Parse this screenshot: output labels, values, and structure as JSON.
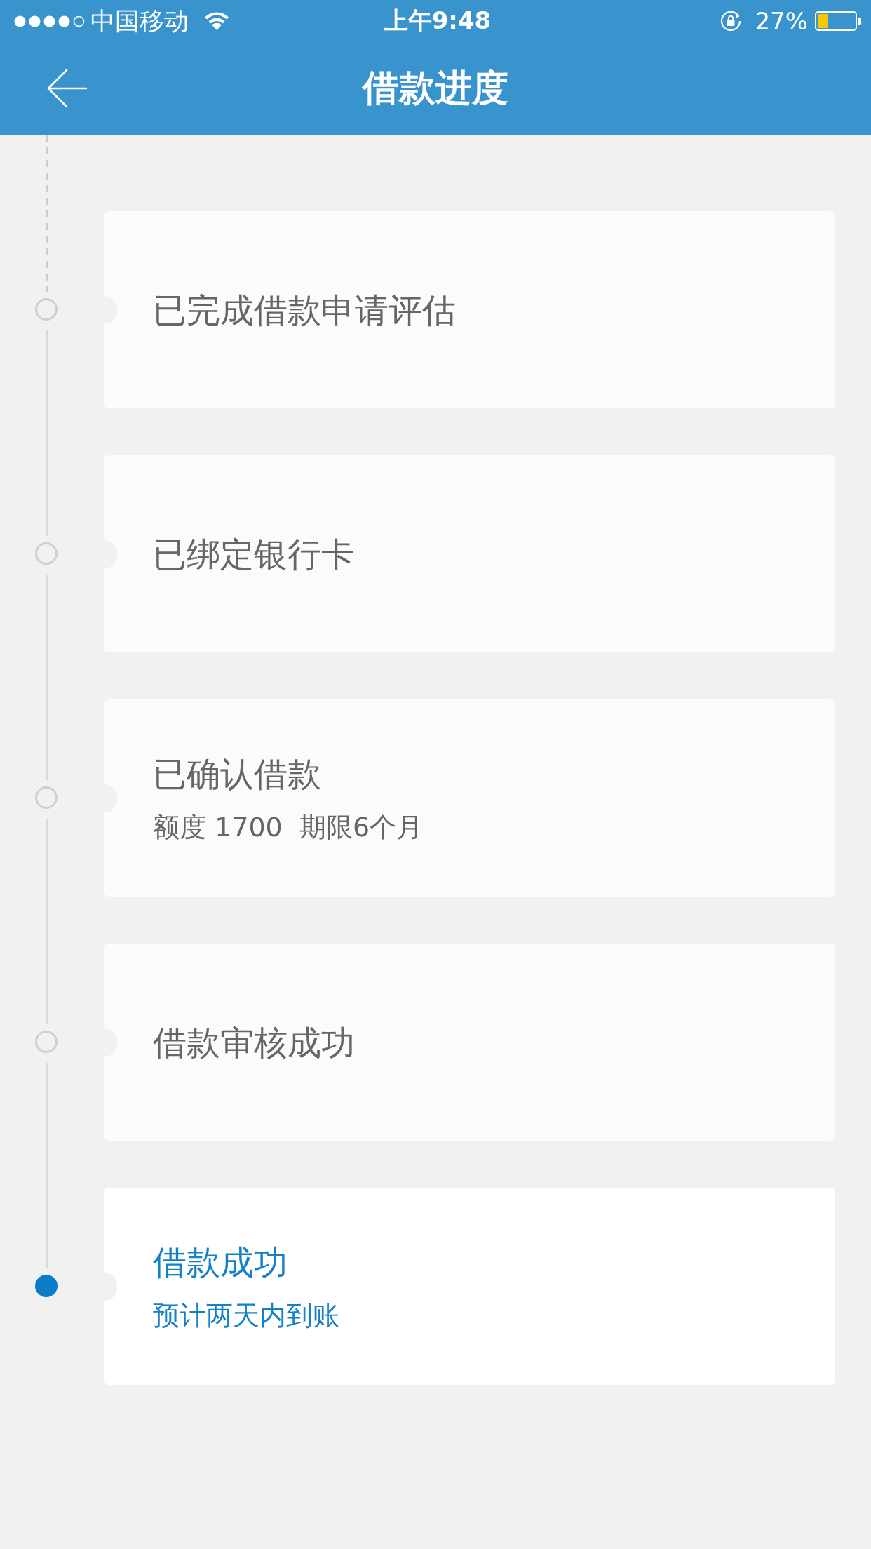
{
  "status_bar": {
    "carrier": "中国移动",
    "time": "上午9:48",
    "battery": "27%"
  },
  "nav_bar": {
    "title": "借款进度"
  },
  "steps": [
    {
      "title": "已完成借款申请评估",
      "current": false
    },
    {
      "title": "已绑定银行卡",
      "current": false
    },
    {
      "title": "已确认借款",
      "detail": "额度 1700  期限6个月",
      "current": false
    },
    {
      "title": "借款审核成功",
      "current": false
    },
    {
      "title": "借款成功",
      "detail": "预计两天内到账",
      "current": true
    }
  ]
}
